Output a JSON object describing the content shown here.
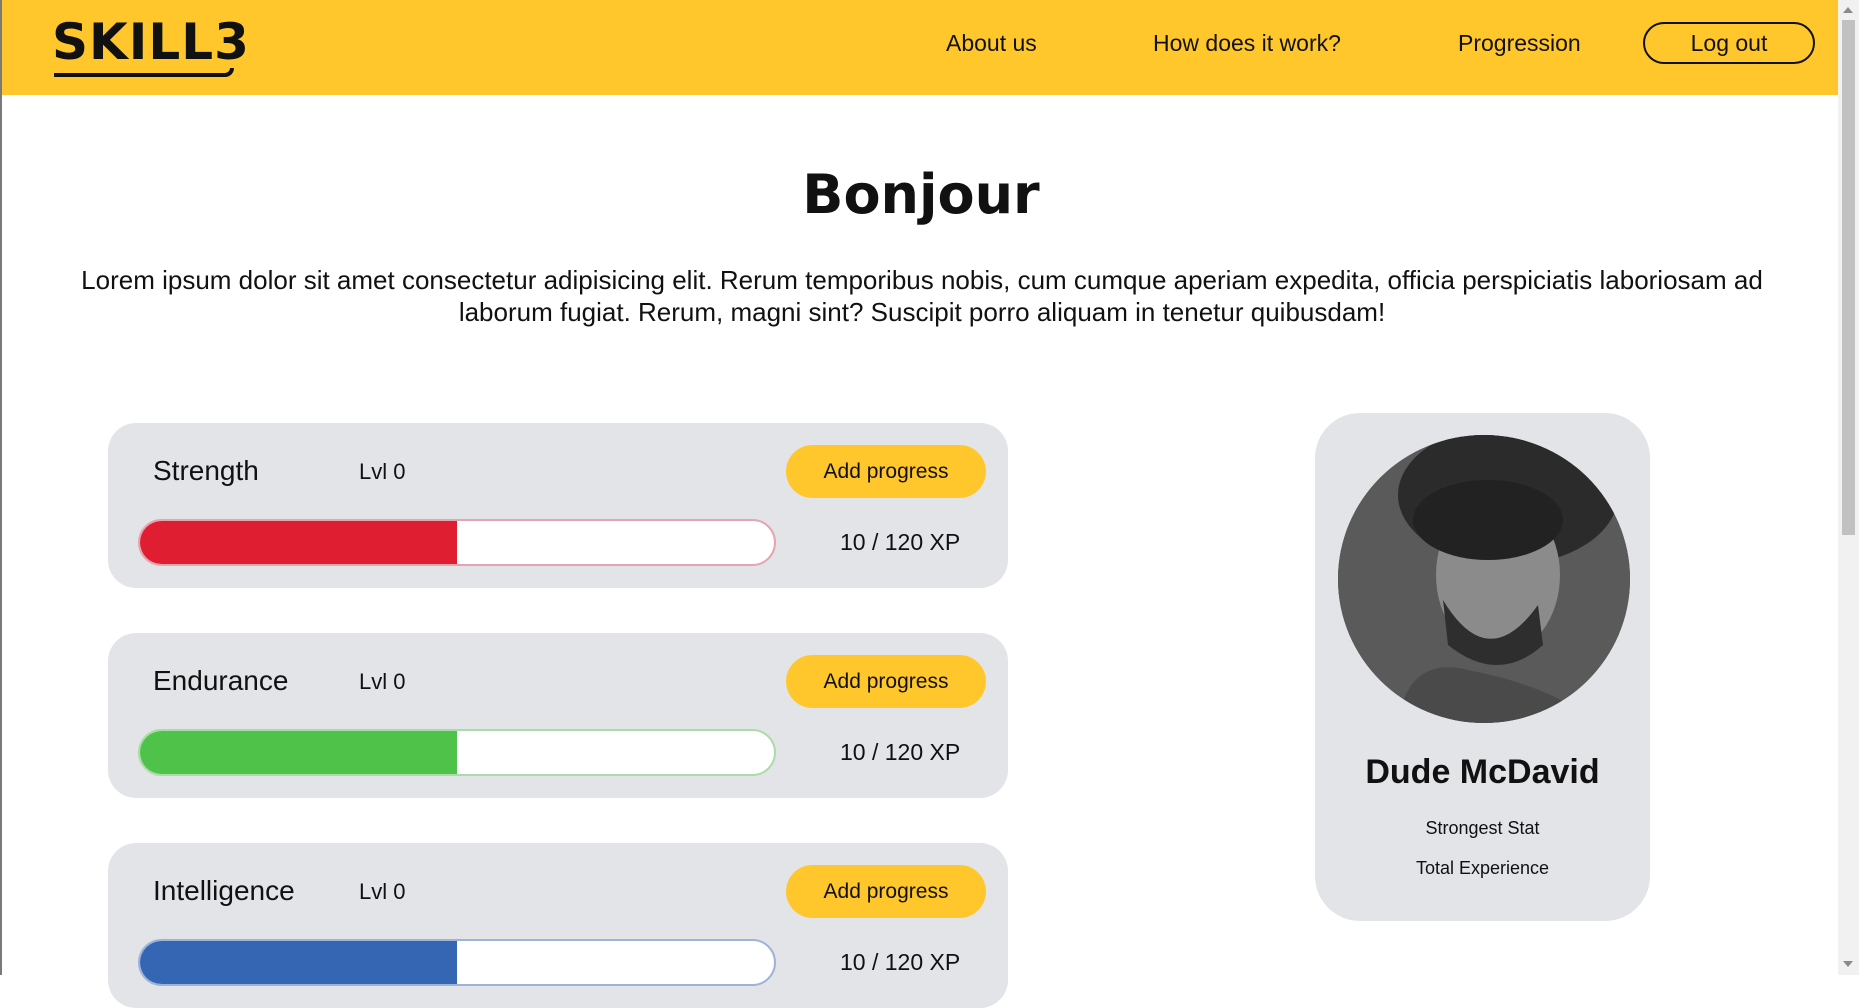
{
  "header": {
    "logo": "SKILL3",
    "nav": [
      "About us",
      "How does it work?",
      "Progression"
    ],
    "logout_label": "Log out",
    "background": "#ffc72c"
  },
  "hero": {
    "title": "Bonjour",
    "intro": "Lorem ipsum dolor sit amet consectetur adipisicing elit. Rerum temporibus nobis, cum cumque aperiam expedita, officia perspiciatis laboriosam ad laborum fugiat. Rerum, magni sint? Suscipit porro aliquam in tenetur quibusdam!"
  },
  "stats": [
    {
      "name": "Strength",
      "level": "Lvl 0",
      "button": "Add progress",
      "xp": "10 / 120 XP",
      "progress": 0.5,
      "color": "#e01e32",
      "border": "#e6a4ae"
    },
    {
      "name": "Endurance",
      "level": "Lvl 0",
      "button": "Add progress",
      "xp": "10 / 120 XP",
      "progress": 0.5,
      "color": "#4fc24a",
      "border": "#a9dca6"
    },
    {
      "name": "Intelligence",
      "level": "Lvl 0",
      "button": "Add progress",
      "xp": "10 / 120 XP",
      "progress": 0.5,
      "color": "#3566b3",
      "border": "#9db3d9"
    }
  ],
  "profile": {
    "name": "Dude McDavid",
    "strongest_stat_label": "Strongest Stat",
    "total_experience_label": "Total Experience",
    "avatar_icon": "user-portrait-photo"
  }
}
